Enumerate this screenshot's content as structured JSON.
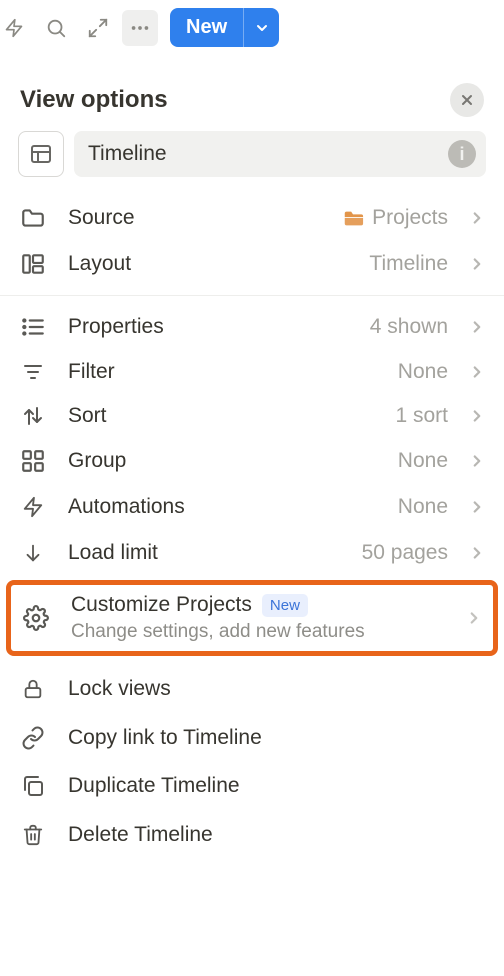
{
  "toolbar": {
    "new_label": "New"
  },
  "panel": {
    "title": "View options",
    "view_name": "Timeline"
  },
  "rows": {
    "source": {
      "label": "Source",
      "value": "Projects"
    },
    "layout": {
      "label": "Layout",
      "value": "Timeline"
    },
    "properties": {
      "label": "Properties",
      "value": "4 shown"
    },
    "filter": {
      "label": "Filter",
      "value": "None"
    },
    "sort": {
      "label": "Sort",
      "value": "1 sort"
    },
    "group": {
      "label": "Group",
      "value": "None"
    },
    "automations": {
      "label": "Automations",
      "value": "None"
    },
    "load_limit": {
      "label": "Load limit",
      "value": "50 pages"
    }
  },
  "customize": {
    "title": "Customize Projects",
    "badge": "New",
    "subtitle": "Change settings, add new features"
  },
  "actions": {
    "lock": "Lock views",
    "copy_link": "Copy link to Timeline",
    "duplicate": "Duplicate Timeline",
    "delete": "Delete Timeline"
  }
}
